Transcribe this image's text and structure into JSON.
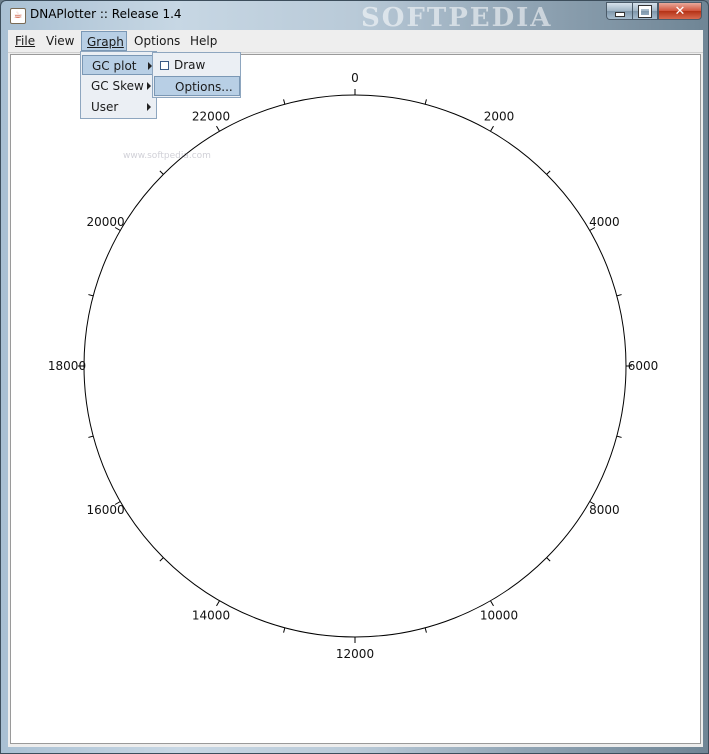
{
  "window": {
    "title": "DNAPlotter :: Release 1.4",
    "icon": "java-cup-icon",
    "controls": {
      "minimize": "minimize-icon",
      "maximize": "maximize-icon",
      "close": "close-icon",
      "close_glyph": "✕"
    },
    "watermark": "SOFTPEDIA",
    "watermark_small": "www.softpedia.com"
  },
  "menubar": {
    "items": [
      {
        "label": "File",
        "mnemonic": "F"
      },
      {
        "label": "View"
      },
      {
        "label": "Graph",
        "mnemonic": "G",
        "active": true
      },
      {
        "label": "Options"
      },
      {
        "label": "Help"
      }
    ]
  },
  "graph_menu": {
    "items": [
      {
        "label": "GC plot",
        "has_submenu": true,
        "active": true
      },
      {
        "label": "GC Skew",
        "has_submenu": true
      },
      {
        "label": "User",
        "has_submenu": true
      }
    ]
  },
  "gc_plot_submenu": {
    "items": [
      {
        "label": "Draw",
        "checkbox": true,
        "checked": false
      },
      {
        "label": "Options...",
        "active": true
      }
    ]
  },
  "colors": {
    "menu_highlight": "#b8cfe5",
    "menu_highlight_border": "#7b98b5",
    "canvas_background": "#ffffff",
    "circle_stroke": "#000000"
  },
  "chart_data": {
    "type": "circular-map",
    "tick_labels": [
      "0",
      "2000",
      "4000",
      "6000",
      "8000",
      "10000",
      "12000",
      "14000",
      "16000",
      "18000",
      "20000",
      "22000"
    ],
    "major_tick_step": 2000,
    "minor_tick_step": 1000,
    "sequence_length": 24000
  }
}
